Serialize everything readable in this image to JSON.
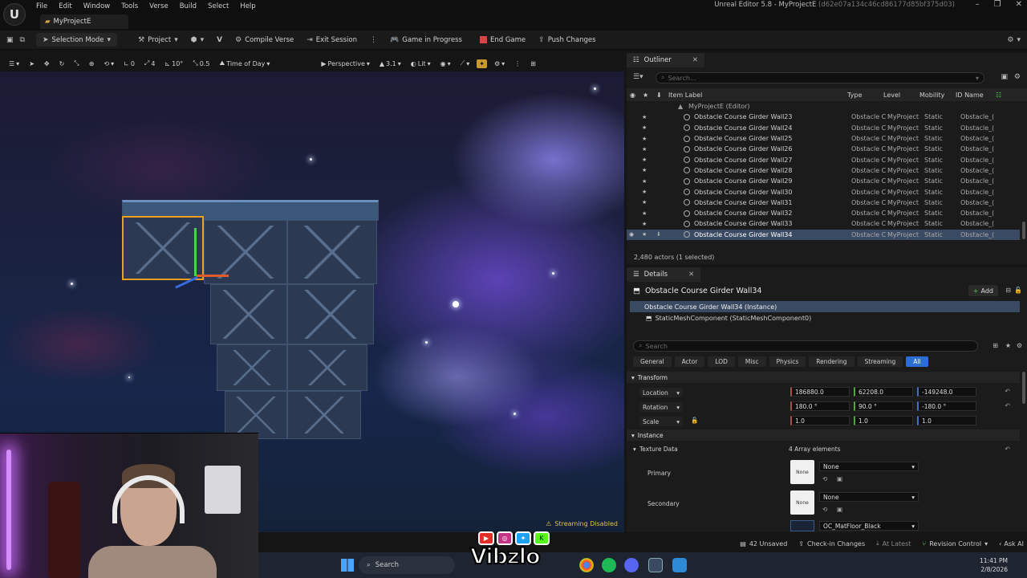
{
  "menu": [
    "File",
    "Edit",
    "Window",
    "Tools",
    "Verse",
    "Build",
    "Select",
    "Help"
  ],
  "project_tab": "MyProjectE",
  "window_title": "Unreal Editor 5.8 - MyProjectE",
  "window_hash": "(d62e07a134c46cd86177d85bf375d03)",
  "toolbar": {
    "selection_mode": "Selection Mode",
    "project": "Project",
    "compile_verse": "Compile Verse",
    "exit_session": "Exit Session",
    "game_in_progress": "Game in Progress",
    "end_game": "End Game",
    "push_changes": "Push Changes"
  },
  "viewport_toolbar": {
    "rot_snap": "0",
    "grid_4": "4",
    "angle": "10°",
    "scale_snap": "0.5",
    "time_of_day": "Time of Day",
    "perspective": "Perspective",
    "speed": "3.1",
    "lit": "Lit"
  },
  "viewport": {
    "streaming": "Streaming Disabled"
  },
  "outliner": {
    "tab": "Outliner",
    "search_placeholder": "Search...",
    "columns": {
      "label": "Item Label",
      "type": "Type",
      "level": "Level",
      "mobility": "Mobility",
      "id": "ID Name"
    },
    "root": "MyProjectE (Editor)",
    "rows": [
      {
        "label": "Obstacle Course Girder Wall23",
        "type": "Obstacle C",
        "level": "MyProject",
        "mobility": "Static",
        "id": "Obstacle_("
      },
      {
        "label": "Obstacle Course Girder Wall24",
        "type": "Obstacle C",
        "level": "MyProject",
        "mobility": "Static",
        "id": "Obstacle_("
      },
      {
        "label": "Obstacle Course Girder Wall25",
        "type": "Obstacle C",
        "level": "MyProject",
        "mobility": "Static",
        "id": "Obstacle_("
      },
      {
        "label": "Obstacle Course Girder Wall26",
        "type": "Obstacle C",
        "level": "MyProject",
        "mobility": "Static",
        "id": "Obstacle_("
      },
      {
        "label": "Obstacle Course Girder Wall27",
        "type": "Obstacle C",
        "level": "MyProject",
        "mobility": "Static",
        "id": "Obstacle_("
      },
      {
        "label": "Obstacle Course Girder Wall28",
        "type": "Obstacle C",
        "level": "MyProject",
        "mobility": "Static",
        "id": "Obstacle_("
      },
      {
        "label": "Obstacle Course Girder Wall29",
        "type": "Obstacle C",
        "level": "MyProject",
        "mobility": "Static",
        "id": "Obstacle_("
      },
      {
        "label": "Obstacle Course Girder Wall30",
        "type": "Obstacle C",
        "level": "MyProject",
        "mobility": "Static",
        "id": "Obstacle_("
      },
      {
        "label": "Obstacle Course Girder Wall31",
        "type": "Obstacle C",
        "level": "MyProject",
        "mobility": "Static",
        "id": "Obstacle_("
      },
      {
        "label": "Obstacle Course Girder Wall32",
        "type": "Obstacle C",
        "level": "MyProject",
        "mobility": "Static",
        "id": "Obstacle_("
      },
      {
        "label": "Obstacle Course Girder Wall33",
        "type": "Obstacle C",
        "level": "MyProject",
        "mobility": "Static",
        "id": "Obstacle_("
      },
      {
        "label": "Obstacle Course Girder Wall34",
        "type": "Obstacle C",
        "level": "MyProject",
        "mobility": "Static",
        "id": "Obstacle_("
      }
    ],
    "footer": "2,480 actors (1 selected)"
  },
  "details": {
    "tab": "Details",
    "actor_name": "Obstacle Course Girder Wall34",
    "add_label": "Add",
    "component_instance": "Obstacle Course Girder Wall34 (Instance)",
    "component_sub": "StaticMeshComponent (StaticMeshComponent0)",
    "search_placeholder": "Search",
    "filters": [
      "General",
      "Actor",
      "LOD",
      "Misc",
      "Physics",
      "Rendering",
      "Streaming",
      "All"
    ],
    "transform": {
      "section": "Transform",
      "location_label": "Location",
      "location": [
        "186880.0",
        "62208.0",
        "-149248.0"
      ],
      "rotation_label": "Rotation",
      "rotation": [
        "180.0 °",
        "90.0 °",
        "-180.0 °"
      ],
      "scale_label": "Scale",
      "scale": [
        "1.0",
        "1.0",
        "1.0"
      ]
    },
    "instance_section": "Instance",
    "texture_data_label": "Texture Data",
    "texture_data_count": "4 Array elements",
    "primary_label": "Primary",
    "primary_thumb": "None",
    "primary_value": "None",
    "secondary_label": "Secondary",
    "secondary_thumb": "None",
    "secondary_value": "None",
    "third_value": "OC_MatFloor_Black"
  },
  "statusbar": {
    "unsaved": "42 Unsaved",
    "check_in": "Check-in Changes",
    "at_latest": "At Latest",
    "revision": "Revision Control",
    "ask_ai": "Ask AI"
  },
  "taskbar": {
    "search": "Search",
    "time": "11:41 PM",
    "date": "2/8/2026"
  },
  "overlay": {
    "brand": "Vibzlo"
  }
}
